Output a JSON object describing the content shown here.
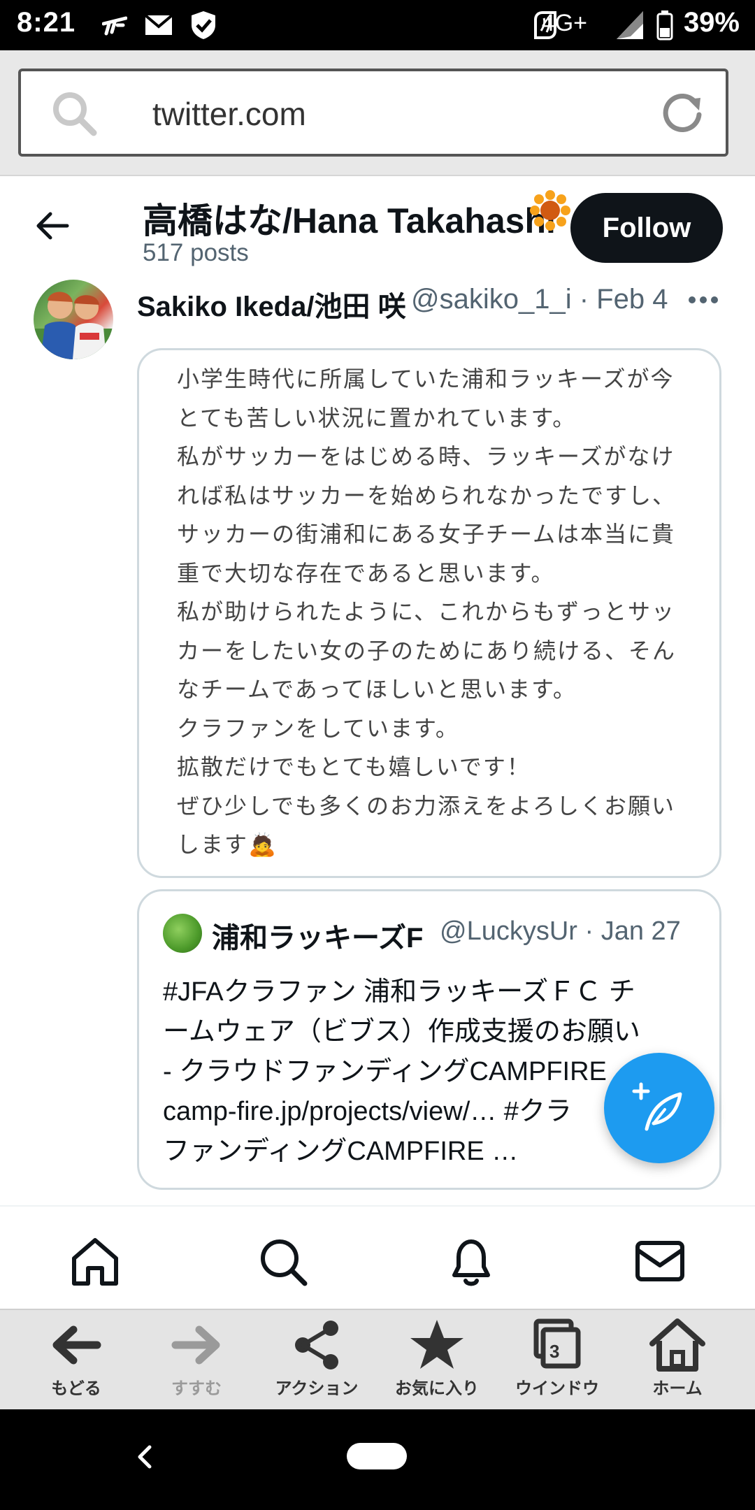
{
  "status_bar": {
    "time": "8:21",
    "network": "4G+",
    "battery": "39%"
  },
  "browser": {
    "url": "twitter.com",
    "toolbar": [
      {
        "label": "もどる",
        "icon": "back-arrow-icon"
      },
      {
        "label": "すすむ",
        "icon": "forward-arrow-icon"
      },
      {
        "label": "アクション",
        "icon": "share-icon"
      },
      {
        "label": "お気に入り",
        "icon": "star-icon"
      },
      {
        "label": "ウインドウ",
        "icon": "windows-icon",
        "count": "3"
      },
      {
        "label": "ホーム",
        "icon": "home-icon"
      }
    ]
  },
  "profile": {
    "name": "高橋はな/Hana Takahashi",
    "posts": "517 posts",
    "follow_label": "Follow"
  },
  "tweet": {
    "author": "Sakiko Ikeda/池田 咲",
    "handle_date": "@sakiko_1_i · Feb 4",
    "text_lines": [
      "小学生時代に所属していた浦和ラッキーズが今",
      "とても苦しい状況に置かれています。",
      "私がサッカーをはじめる時、ラッキーズがなけ",
      "れば私はサッカーを始められなかったですし、",
      "サッカーの街浦和にある女子チームは本当に貴",
      "重で大切な存在であると思います。",
      "私が助けられたように、これからもずっとサッ",
      "カーをしたい女の子のためにあり続ける、そん",
      "なチームであってほしいと思います。",
      "クラファンをしています。",
      "拡散だけでもとても嬉しいです！",
      "ぜひ少しでも多くのお力添えをよろしくお願い",
      "します🙇"
    ],
    "quote": {
      "author": "浦和ラッキーズF",
      "handle_date": "@LuckysUr · Jan 27",
      "lines": [
        "#JFAクラファン 浦和ラッキーズＦＣ チ",
        "ームウェア（ビブス）作成支援のお願い",
        "- クラウドファンディングCAMPFIRE",
        "camp-fire.jp/projects/view/… #クラ",
        "ファンディングCAMPFIRE …"
      ]
    }
  },
  "colors": {
    "accent": "#1d9bf0",
    "follow_bg": "#0f1419",
    "muted": "#536471"
  }
}
